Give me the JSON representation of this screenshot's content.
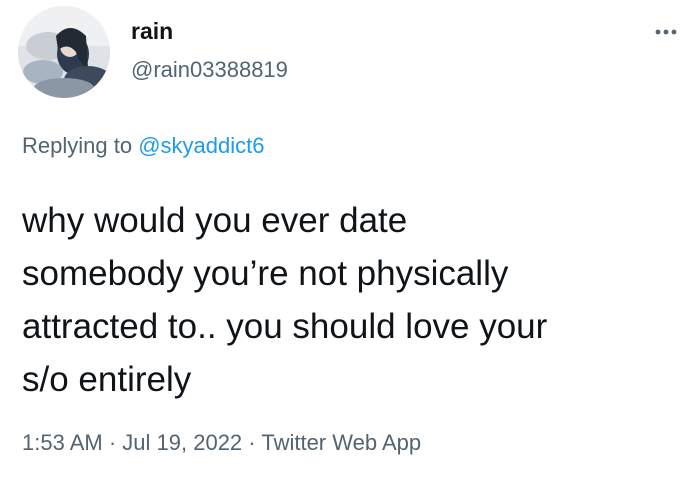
{
  "user": {
    "display_name": "rain",
    "handle": "@rain03388819"
  },
  "reply": {
    "prefix": "Replying to",
    "mention": "@skyaddict6"
  },
  "tweet": {
    "text": "why would you ever date\nsomebody you’re not physically\nattracted to.. you should love your\ns/o entirely"
  },
  "meta": {
    "time": "1:53 AM",
    "separator": "·",
    "date": "Jul 19, 2022",
    "source": "Twitter Web App"
  },
  "icons": {
    "more": "more-horizontal-icon",
    "avatar": "avatar-image"
  },
  "colors": {
    "text_primary": "#0f1419",
    "text_secondary": "#536471",
    "accent": "#1d9bf0"
  }
}
